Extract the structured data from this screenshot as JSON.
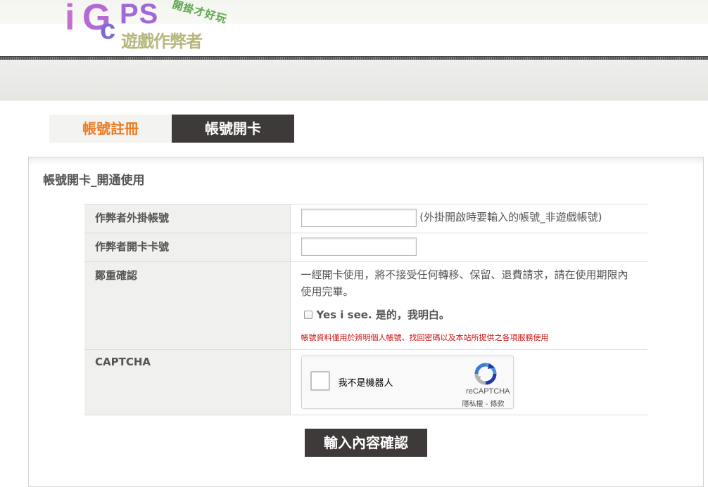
{
  "header": {
    "logo": {
      "letters": [
        "i",
        "G",
        "c",
        "PS"
      ],
      "chinese": "遊戲作弊者",
      "slogan": "開掛才好玩"
    }
  },
  "tabs": [
    {
      "label": "帳號註冊",
      "active": false
    },
    {
      "label": "帳號開卡",
      "active": true
    }
  ],
  "panel": {
    "title": "帳號開卡_開通使用",
    "rows": {
      "account": {
        "label": "作弊者外掛帳號",
        "value": "",
        "hint": "(外掛開啟時要輸入的帳號_非遊戲帳號)"
      },
      "card": {
        "label": "作弊者開卡卡號",
        "value": ""
      },
      "confirm": {
        "label": "鄭重確認",
        "notice": "一經開卡使用，將不接受任何轉移、保留、退費請求，請在使用期限內使用完畢。",
        "agree_label": "Yes i see. 是的，我明白。",
        "agree_checked": false,
        "privacy_note": "帳號資料僅用於辨明個人帳號、找回密碼以及本站所提供之各項服務使用"
      },
      "captcha": {
        "label": "CAPTCHA",
        "checkbox_label": "我不是機器人",
        "brand": "reCAPTCHA",
        "terms": "隱私權 - 條款"
      }
    },
    "submit_label": "輸入內容確認"
  },
  "colors": {
    "active_tab_bg": "#3d3a39",
    "inactive_tab_text": "#f07a1e",
    "notice_red": "#cc1111",
    "label_bg": "#f0f0ee"
  }
}
